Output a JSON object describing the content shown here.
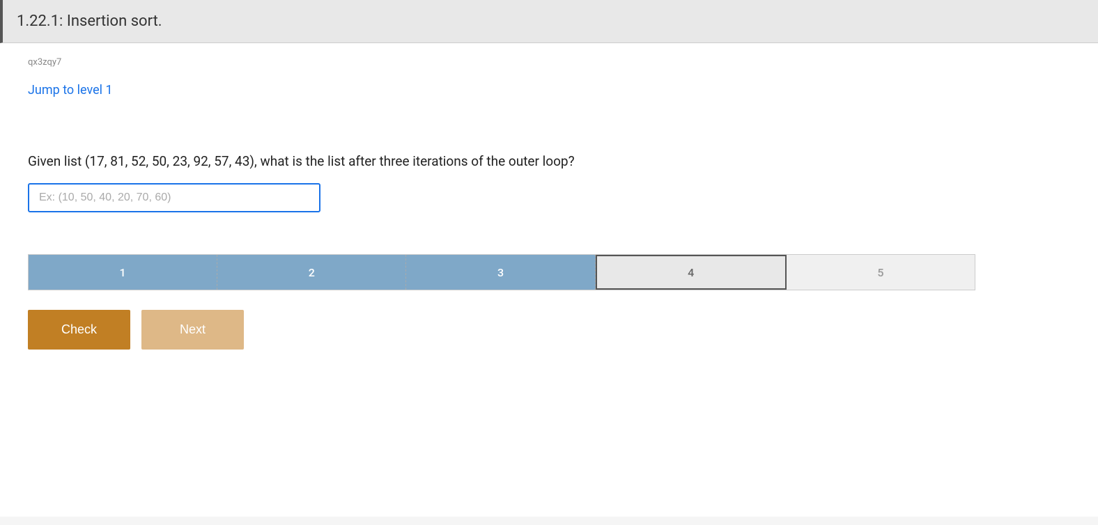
{
  "header": {
    "title": "1.22.1: Insertion sort."
  },
  "session": {
    "id": "qx3zqy7"
  },
  "jump_link": {
    "label": "Jump to level 1"
  },
  "question": {
    "text": "Given list (17, 81, 52, 50, 23, 92, 57, 43), what is the list after three iterations of the outer loop?",
    "input_placeholder": "Ex: (10, 50, 40, 20, 70, 60)",
    "input_value": ""
  },
  "progress": {
    "segments": [
      {
        "label": "1",
        "state": "completed"
      },
      {
        "label": "2",
        "state": "completed"
      },
      {
        "label": "3",
        "state": "completed"
      },
      {
        "label": "4",
        "state": "active"
      },
      {
        "label": "5",
        "state": "inactive"
      }
    ]
  },
  "buttons": {
    "check_label": "Check",
    "next_label": "Next"
  }
}
